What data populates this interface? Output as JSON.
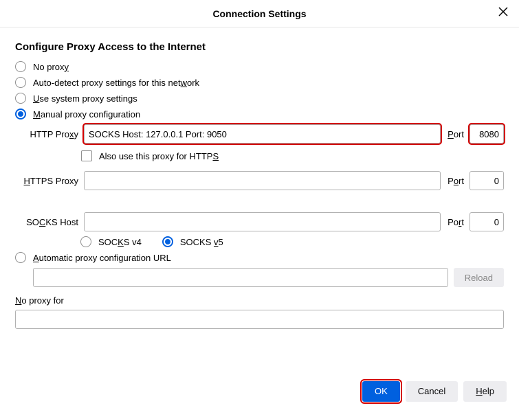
{
  "window": {
    "title": "Connection Settings"
  },
  "section_title": "Configure Proxy Access to the Internet",
  "radios": {
    "no_proxy": "No proxy",
    "auto_detect": "Auto-detect proxy settings for this network",
    "system": "Use system proxy settings",
    "manual": "Manual proxy configuration",
    "auto_url": "Automatic proxy configuration URL"
  },
  "labels": {
    "http_proxy": "HTTP Proxy",
    "https_proxy": "HTTPS Proxy",
    "socks_host": "SOCKS Host",
    "port": "Port",
    "also_https": "Also use this proxy for HTTPS",
    "socks_v4": "SOCKS v4",
    "socks_v5": "SOCKS v5",
    "no_proxy_for": "No proxy for"
  },
  "values": {
    "http_host": "SOCKS Host: 127.0.0.1 Port: 9050",
    "http_port": "8080",
    "https_host": "",
    "https_port": "0",
    "socks_host": "",
    "socks_port": "0",
    "pac_url": "",
    "no_proxy_for": ""
  },
  "buttons": {
    "reload": "Reload",
    "ok": "OK",
    "cancel": "Cancel",
    "help": "Help"
  }
}
